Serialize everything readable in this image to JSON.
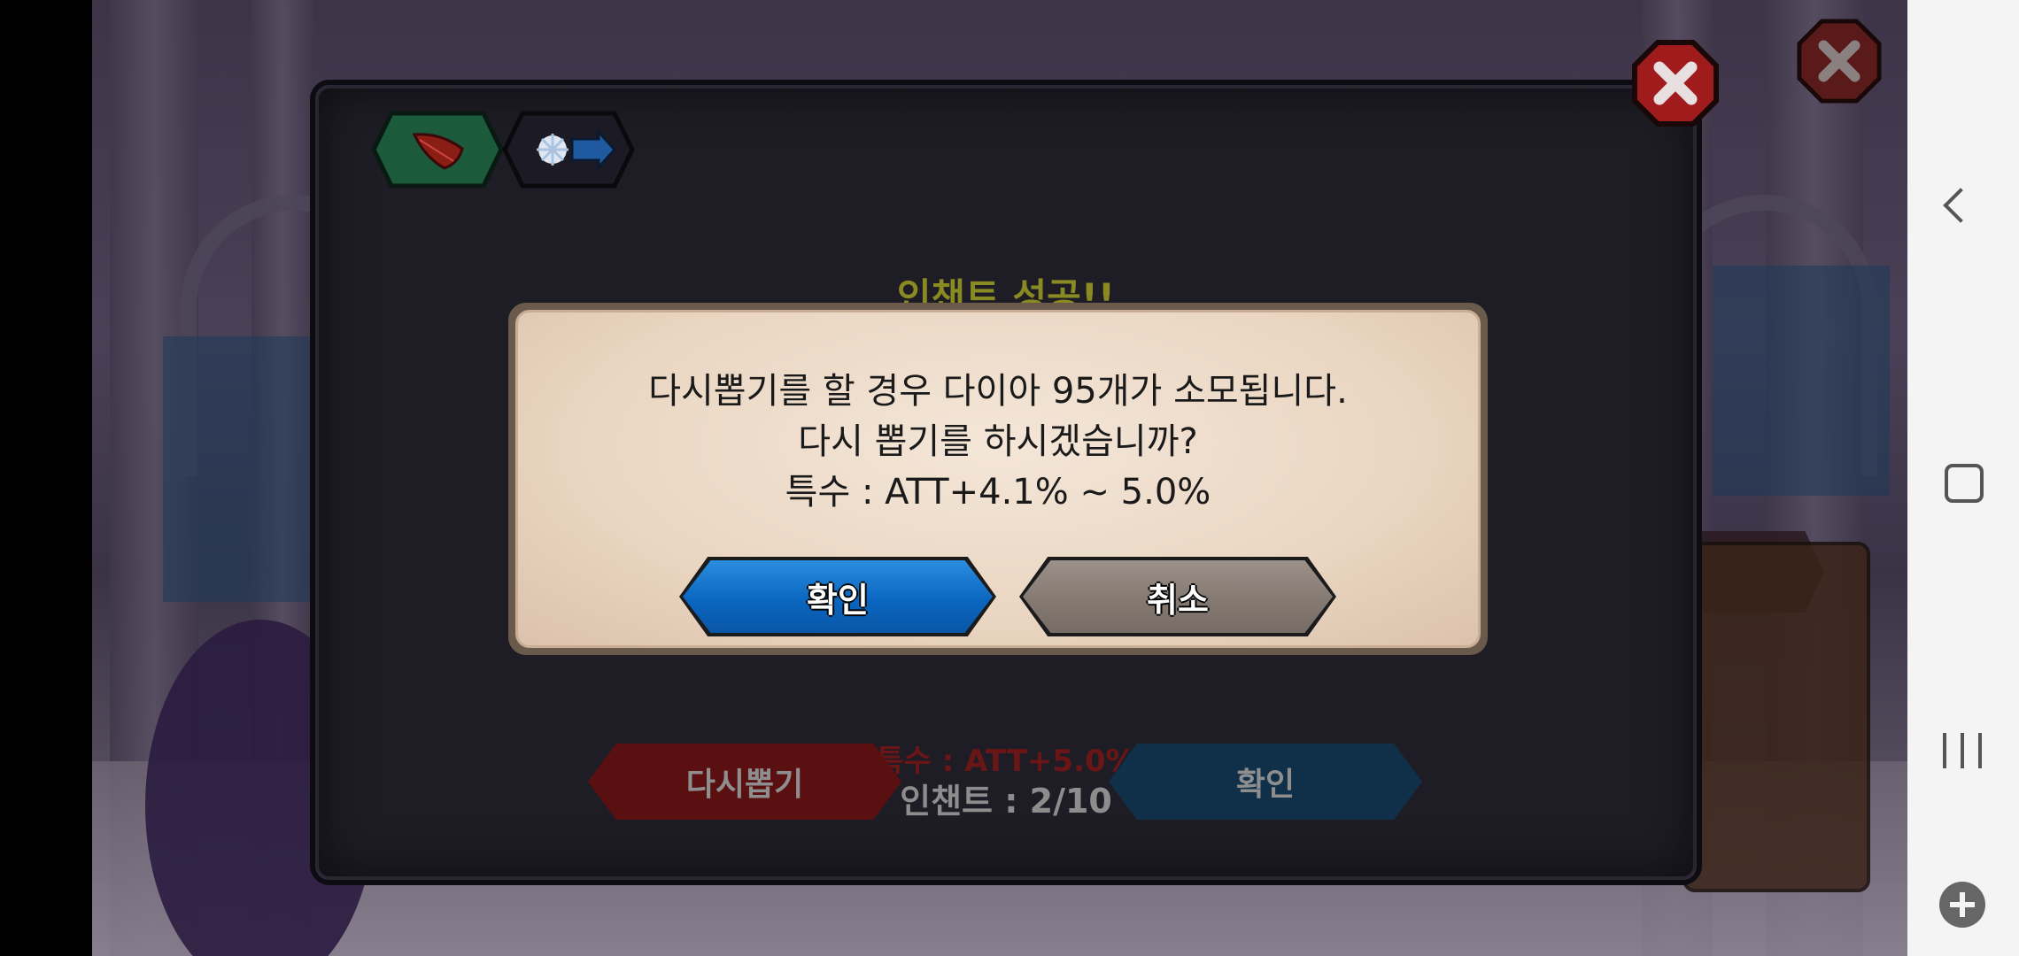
{
  "game": {
    "enchant_panel": {
      "title": "인챈트 성공!!",
      "special_stat": "특수 : ATT+5.0%",
      "enchant_level": "인챈트 : 2/10",
      "reroll_button": "다시뽑기",
      "confirm_button": "확인",
      "icons": [
        "feather-icon",
        "enchant-arrow-icon",
        "close-icon"
      ]
    },
    "dialog": {
      "line1": "다시뽑기를 할 경우 다이아 95개가 소모됩니다.",
      "line2": "다시 뽑기를 하시겠습니까?",
      "line3": "특수 : ATT+4.1% ~ 5.0%",
      "confirm_label": "확인",
      "cancel_label": "취소"
    },
    "colors": {
      "title": "#8a8a22",
      "special_stat": "#6b1616",
      "confirm_blue": "#0b66c0",
      "cancel_gray": "#857a72",
      "reroll_red": "#5a1010"
    }
  },
  "system_nav": {
    "icons": [
      "back-icon",
      "home-icon",
      "recent-apps-icon",
      "game-tools-icon"
    ]
  }
}
